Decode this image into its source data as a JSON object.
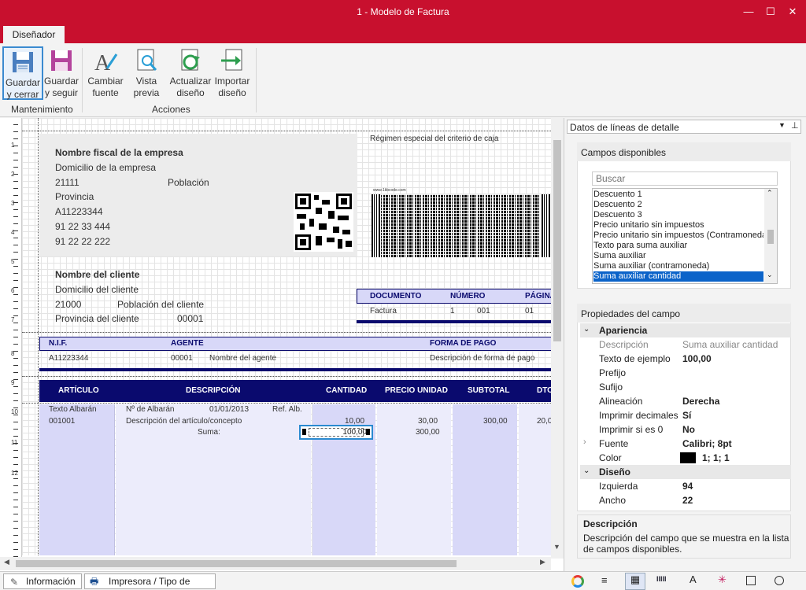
{
  "window": {
    "title": "1 - Modelo de Factura",
    "minimize": "—",
    "maximize": "☐",
    "close": "✕"
  },
  "ribbon": {
    "tab": "Diseñador",
    "buttons": [
      {
        "line1": "Guardar",
        "line2": "y cerrar"
      },
      {
        "line1": "Guardar",
        "line2": "y seguir"
      },
      {
        "line1": "Cambiar",
        "line2": "fuente"
      },
      {
        "line1": "Vista",
        "line2": "previa"
      },
      {
        "line1": "Actualizar",
        "line2": "diseño"
      },
      {
        "line1": "Importar",
        "line2": "diseño"
      }
    ],
    "groups": {
      "mantenimiento": "Mantenimiento",
      "acciones": "Acciones"
    }
  },
  "ruler": {
    "numbers": [
      "1",
      "2",
      "3",
      "4",
      "5",
      "6",
      "7",
      "8",
      "9",
      "10",
      "11",
      "12"
    ]
  },
  "invoice": {
    "company": {
      "name": "Nombre fiscal de la empresa",
      "address": "Domicilio de la empresa",
      "zip": "21111",
      "city": "Población",
      "province": "Provincia",
      "nif": "A11223344",
      "phone1": "91 22 33 444",
      "phone2": "91 22 22 222"
    },
    "regimen": "Régimen especial del criterio de caja",
    "barcode_caption": "www.1kbcode.com",
    "client": {
      "name": "Nombre del cliente",
      "address": "Domicilio del cliente",
      "zip": "21000",
      "city": "Población del cliente",
      "province": "Provincia del cliente",
      "code": "00001"
    },
    "doc_headers": {
      "documento": "DOCUMENTO",
      "numero": "NÚMERO",
      "pagina": "PÁGINA"
    },
    "doc_values": {
      "documento": "Factura",
      "serie": "1",
      "numero": "001",
      "pagina": "01"
    },
    "meta_headers": {
      "nif": "N.I.F.",
      "agente": "AGENTE",
      "forma": "FORMA DE PAGO"
    },
    "meta_values": {
      "nif": "A11223344",
      "agente_code": "00001",
      "agente_name": "Nombre del agente",
      "forma": "Descripción de forma de pago"
    },
    "lines_headers": {
      "articulo": "ARTÍCULO",
      "descripcion": "DESCRIPCIÓN",
      "cantidad": "CANTIDAD",
      "precio": "PRECIO UNIDAD",
      "subtotal": "SUBTOTAL",
      "dto": "DTO"
    },
    "line": {
      "art_label": "Texto Albarán",
      "art_code": "001001",
      "albaran": "Nº de Albarán",
      "fecha": "01/01/2013",
      "ref": "Ref. Alb.",
      "desc": "Descripción del artículo/concepto",
      "suma_label": "Suma:",
      "cantidad": "10,00",
      "suma_cantidad": "100,00",
      "precio": "30,00",
      "precio_sum": "300,00",
      "subtotal": "300,00",
      "dto": "20,0"
    }
  },
  "bottom_tabs": {
    "info": "Información",
    "printer": "Impresora / Tipo de papel"
  },
  "panel": {
    "dropdown": "Datos de líneas de detalle",
    "campos_title": "Campos disponibles",
    "search_placeholder": "Buscar",
    "fields": [
      "Descuento 1",
      "Descuento 2",
      "Descuento 3",
      "Precio unitario sin impuestos",
      "Precio unitario sin impuestos (Contramoneda)",
      "Texto para suma auxiliar",
      "Suma auxiliar",
      "Suma auxiliar (contramoneda)",
      "Suma auxiliar cantidad"
    ],
    "props_title": "Propiedades del campo",
    "apariencia": "Apariencia",
    "diseno": "Diseño",
    "props": [
      {
        "k": "Descripción",
        "v": "Suma auxiliar cantidad"
      },
      {
        "k": "Texto de ejemplo",
        "v": "100,00"
      },
      {
        "k": "Prefijo",
        "v": ""
      },
      {
        "k": "Sufijo",
        "v": ""
      },
      {
        "k": "Alineación",
        "v": "Derecha"
      },
      {
        "k": "Imprimir decimales",
        "v": "Sí"
      },
      {
        "k": "Imprimir si es 0",
        "v": "No"
      },
      {
        "k": "Fuente",
        "v": "Calibri; 8pt"
      },
      {
        "k": "Color",
        "v": "1; 1; 1"
      },
      {
        "k": "Izquierda",
        "v": "94"
      },
      {
        "k": "Ancho",
        "v": "22"
      }
    ],
    "desc_title": "Descripción",
    "desc_text1": "Descripción del campo que se muestra en la lista",
    "desc_text2": "de campos disponibles."
  },
  "colors": {
    "accent": "#c8102e",
    "navy": "#0a0a6e",
    "lavender": "#d8d8f8"
  }
}
